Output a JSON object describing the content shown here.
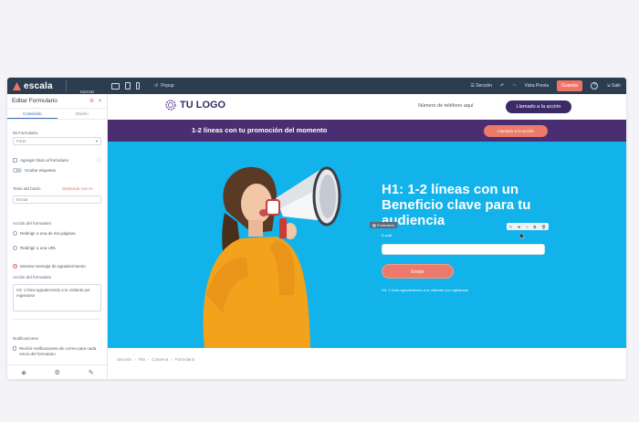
{
  "app": {
    "logo_text": "escala",
    "editor_label": "EDITOR",
    "popup_label": "Popup",
    "undo_label": "Sección",
    "preview_label": "Vista Previa",
    "save_label": "Guardar",
    "help_label": "?",
    "exit_label": "Salir"
  },
  "sidebar": {
    "title": "Editar Formulario",
    "tabs": [
      "Contenido",
      "Diseño"
    ],
    "form_type_label": "Mi Formulario",
    "form_type_value": "Form",
    "add_title_label": "Agregar título al formulario",
    "hide_labels_label": "Ocultar etiquetas",
    "button_text_label": "Texto del botón",
    "button_extra_label": "Gestionar con IA",
    "button_text_value": "Enviar",
    "form_action_label": "Acción del formulario",
    "redirect_page_label": "Redirigir a una de mis páginas",
    "redirect_url_label": "Redirigir a una URL",
    "show_thanks_label": "Mostrar mensaje de agradecimiento",
    "thanks_action_label": "Acción del formulario",
    "thanks_text": "H3: 1 línea agradeciendo a tu visitante por registrarse",
    "notifications_label": "Notificaciones",
    "notif_check_label": "Recibir notificaciones de correo para cada envío del formulario"
  },
  "site": {
    "logo_text": "TU LOGO",
    "phone": "Número de teléfono aquí",
    "header_cta": "Llamado a la acción",
    "promo_text": "1-2 líneas con tu promoción del momento",
    "promo_cta": "Llamado a la acción",
    "hero_title": "H1: 1-2 líneas con un Beneficio clave para tu audiencia",
    "form_tag": "Formulario",
    "email_label": "E-mail",
    "submit_label": "Enviar",
    "thanks": "H3: 1 línea agradeciendo a tu visitante por registrarse"
  },
  "breadcrumb": [
    "Sección",
    "Fila",
    "Columna",
    "Formulario"
  ],
  "colors": {
    "topbar": "#2b3d4f",
    "brand_purple": "#4b2d72",
    "hero_blue": "#12b2ea",
    "accent_coral": "#ec7a6a",
    "person_yellow": "#f2a21b"
  }
}
